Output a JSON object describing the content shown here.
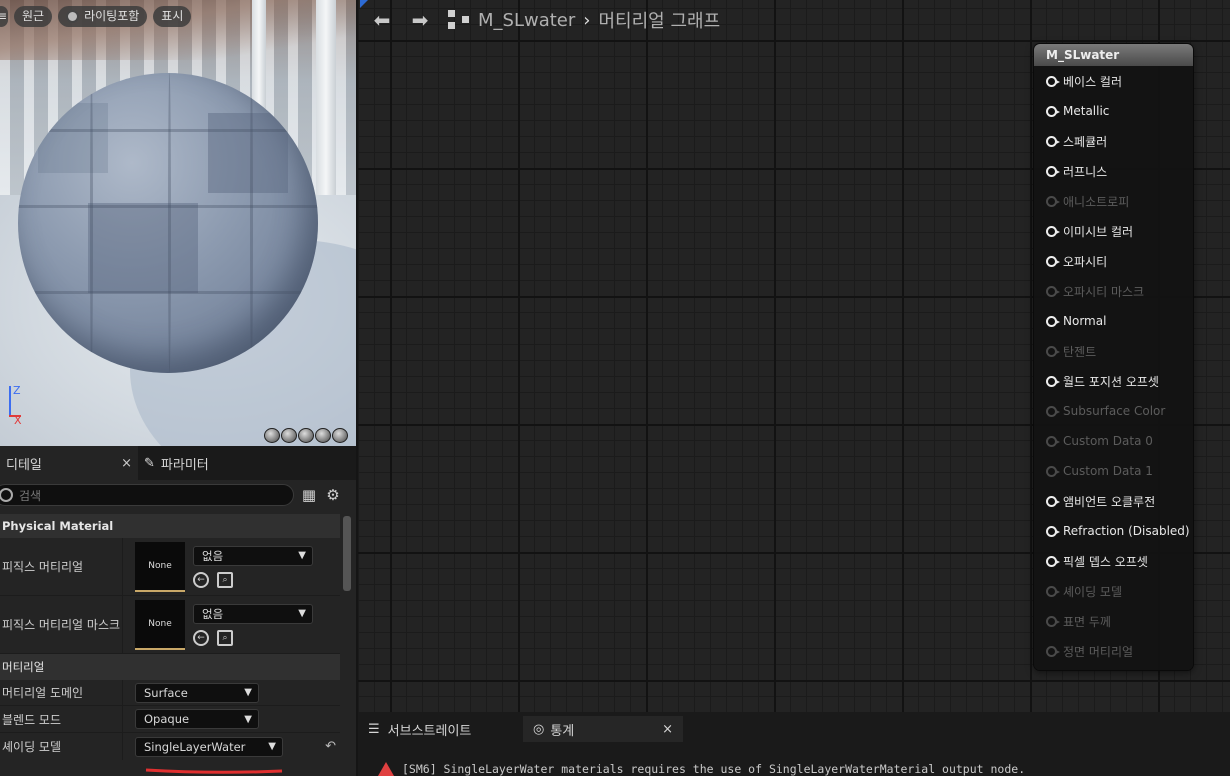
{
  "viewport": {
    "toolbar": {
      "perspective": "원근",
      "lighting": "라이팅포함",
      "show": "표시"
    },
    "axis": {
      "z": "Z",
      "x": "X"
    }
  },
  "details": {
    "tabs": [
      {
        "label": "디테일",
        "close": "×"
      },
      {
        "label": "파라미터"
      }
    ],
    "search_placeholder": "검색",
    "categories": {
      "physical": "Physical Material",
      "material": "머티리얼"
    },
    "props": {
      "phys_material": {
        "label": "피직스 머티리얼",
        "thumb": "None",
        "value": "없음"
      },
      "phys_mask": {
        "label": "피직스 머티리얼 마스크",
        "thumb": "None",
        "value": "없음"
      },
      "domain": {
        "label": "머티리얼 도메인",
        "value": "Surface"
      },
      "blend": {
        "label": "블렌드 모드",
        "value": "Opaque"
      },
      "shading": {
        "label": "셰이딩 모델",
        "value": "SingleLayerWater"
      }
    }
  },
  "graph": {
    "breadcrumb": {
      "asset": "M_SLwater",
      "sep": "›",
      "page": "머티리얼 그래프"
    },
    "node": {
      "title": "M_SLwater",
      "pins": [
        {
          "label": "베이스 컬러",
          "enabled": true
        },
        {
          "label": "Metallic",
          "enabled": true
        },
        {
          "label": "스페큘러",
          "enabled": true
        },
        {
          "label": "러프니스",
          "enabled": true
        },
        {
          "label": "애니소트로피",
          "enabled": false
        },
        {
          "label": "이미시브 컬러",
          "enabled": true
        },
        {
          "label": "오파시티",
          "enabled": true
        },
        {
          "label": "오파시티 마스크",
          "enabled": false
        },
        {
          "label": "Normal",
          "enabled": true
        },
        {
          "label": "탄젠트",
          "enabled": false
        },
        {
          "label": "월드 포지션 오프셋",
          "enabled": true
        },
        {
          "label": "Subsurface Color",
          "enabled": false
        },
        {
          "label": "Custom Data 0",
          "enabled": false
        },
        {
          "label": "Custom Data 1",
          "enabled": false
        },
        {
          "label": "앰비언트 오클루전",
          "enabled": true
        },
        {
          "label": "Refraction (Disabled)",
          "enabled": true
        },
        {
          "label": "픽셀 뎁스 오프셋",
          "enabled": true
        },
        {
          "label": "셰이딩 모델",
          "enabled": false
        },
        {
          "label": "표면 두께",
          "enabled": false
        },
        {
          "label": "정면 머티리얼",
          "enabled": false
        }
      ]
    }
  },
  "bottom": {
    "tabs": [
      {
        "label": "서브스트레이트"
      },
      {
        "label": "통계",
        "close": "×"
      }
    ],
    "message": "[SM6] SingleLayerWater materials requires the use of SingleLayerWaterMaterial output node."
  },
  "colors": {
    "accent_gold": "#c9a868",
    "error_red": "#e04040",
    "axis_blue": "#3c6df0",
    "axis_red": "#e03a3a"
  }
}
